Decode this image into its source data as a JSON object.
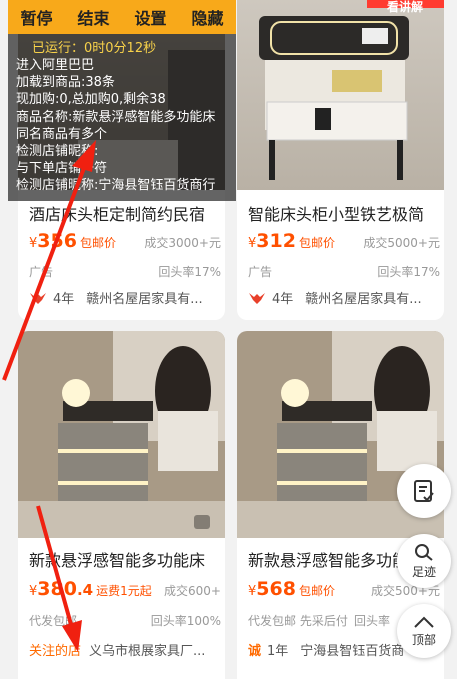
{
  "colors": {
    "accent": "#ff5000",
    "overlay_bar": "#f8a91a",
    "arrow": "#f02010"
  },
  "overlay": {
    "buttons": [
      "暂停",
      "结束",
      "设置",
      "隐藏"
    ],
    "runtime": "已运行：0时0分12秒",
    "log": [
      "进入阿里巴巴",
      "加载到商品:38条",
      "现加购:0,总加购0,剩余38",
      "商品名称:新款悬浮感智能多功能床",
      "同名商品有多个",
      "检测店铺昵称:",
      "与下单店铺一符",
      "检测店铺昵称:宁海县智钰百货商行"
    ]
  },
  "top_right_tag": "看讲解",
  "products": [
    {
      "title": "酒店床头柜定制简约民宿",
      "currency": "¥",
      "price": "356",
      "price_tag": "包邮价",
      "sold": "成交3000+元",
      "left_meta": "广告",
      "repurchase": "回头率17%",
      "badge_icon": "ox-badge-icon",
      "years": "4年",
      "shop": "赣州名屋居家具有..."
    },
    {
      "title": "智能床头柜小型铁艺极简",
      "currency": "¥",
      "price": "312",
      "price_tag": "包邮价",
      "sold": "成交5000+元",
      "left_meta": "广告",
      "repurchase": "回头率17%",
      "badge_icon": "ox-badge-icon",
      "years": "4年",
      "shop": "赣州名屋居家具有..."
    },
    {
      "title": "新款悬浮感智能多功能床",
      "currency": "¥",
      "price": "380",
      "price_decimal": ".4",
      "price_tag": "运费1元起",
      "sold": "成交600+",
      "left_meta": "代发包邮",
      "repurchase": "回头率100%",
      "follow": "关注的店",
      "shop": "义乌市根展家具厂..."
    },
    {
      "title": "新款悬浮感智能多功能",
      "currency": "¥",
      "price": "568",
      "price_tag": "包邮价",
      "sold": "成交500+元",
      "left_meta": "代发包邮  先采后付",
      "repurchase": "回头率",
      "badge_text": "诚",
      "years": "1年",
      "shop": "宁海县智钰百货商"
    }
  ],
  "float_buttons": {
    "list_icon": "checklist-icon",
    "footprint": "足迹",
    "top": "顶部"
  }
}
